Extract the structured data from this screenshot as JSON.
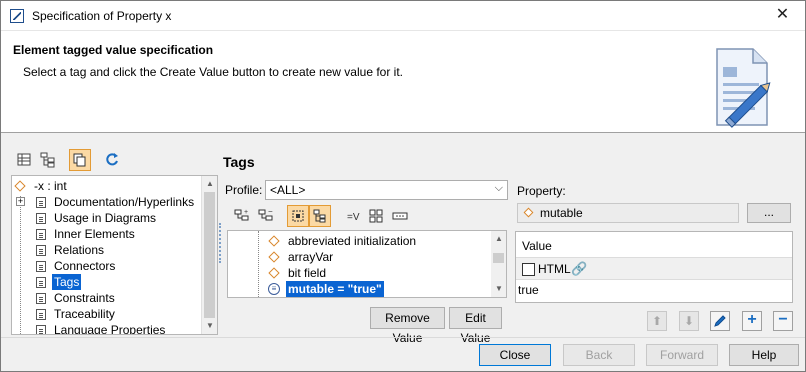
{
  "window": {
    "title": "Specification of Property x",
    "close_glyph": "✕"
  },
  "header": {
    "title": "Element tagged value specification",
    "description": "Select a tag and click the Create Value button to create new value for it.",
    "art_icon": "document-pencil-icon"
  },
  "left_toolbar": {
    "icons": [
      "table-view-icon",
      "tree-view-icon",
      "copy-icon",
      "refresh-icon"
    ]
  },
  "tree": {
    "root": "-x : int",
    "items": [
      {
        "label": "Documentation/Hyperlinks"
      },
      {
        "label": "Usage in Diagrams"
      },
      {
        "label": "Inner Elements"
      },
      {
        "label": "Relations"
      },
      {
        "label": "Connectors"
      },
      {
        "label": "Tags"
      },
      {
        "label": "Constraints"
      },
      {
        "label": "Traceability"
      },
      {
        "label": "Language Properties"
      }
    ],
    "selected": "Tags"
  },
  "tags": {
    "title": "Tags",
    "profile_label": "Profile:",
    "profile_value": "<ALL>",
    "list": [
      {
        "label": "abbreviated initialization"
      },
      {
        "label": "arrayVar"
      },
      {
        "label": "bit field"
      },
      {
        "label": "mutable = \"true\""
      }
    ],
    "remove_button": "Remove Value",
    "edit_button": "Edit Value"
  },
  "property": {
    "label": "Property:",
    "value": "mutable",
    "browse_button": "...",
    "value_header": "Value",
    "html_label": "HTML",
    "html_checked": false,
    "value_text": "true"
  },
  "footer": {
    "close": "Close",
    "back": "Back",
    "forward": "Forward",
    "help": "Help"
  }
}
